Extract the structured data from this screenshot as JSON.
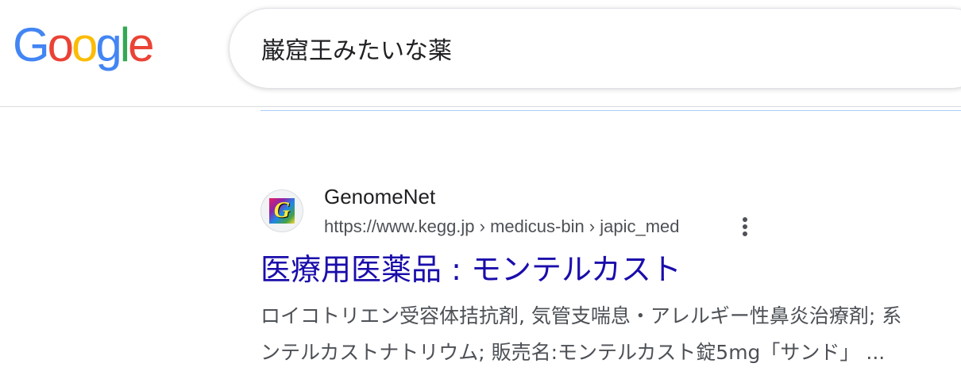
{
  "logo": {
    "letters": [
      "G",
      "o",
      "o",
      "g",
      "l",
      "e"
    ],
    "colors": [
      "#4285F4",
      "#EA4335",
      "#FBBC05",
      "#4285F4",
      "#34A853",
      "#EA4335"
    ]
  },
  "search": {
    "query": "巌窟王みたいな薬"
  },
  "result": {
    "favicon_icon": "genomenet-favicon-icon",
    "favicon_letter": "G",
    "site_name": "GenomeNet",
    "url": "https://www.kegg.jp › medicus-bin › japic_med",
    "more_icon": "vertical-ellipsis-icon",
    "title": "医療用医薬品 : モンテルカスト",
    "snippet_line1": "ロイコトリエン受容体拮抗剤, 気管支喘息・アレルギー性鼻炎治療剤; 系",
    "snippet_line2": "ンテルカストナトリウム; 販売名:モンテルカスト錠5mg「サンド」 ..."
  },
  "colors": {
    "link": "#1a0dab",
    "text": "#202124",
    "muted": "#4d5156",
    "divider": "#dadce0"
  }
}
